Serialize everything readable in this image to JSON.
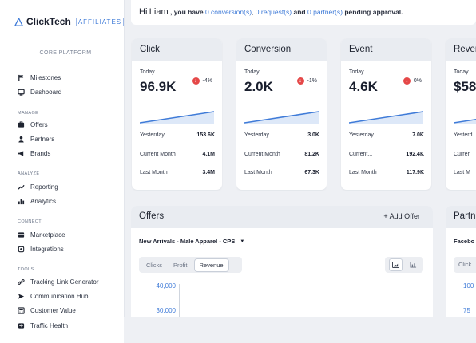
{
  "brand": {
    "name": "ClickTech",
    "affiliates": "AFFILIATES"
  },
  "sidebar": {
    "core_label": "CORE PLATFORM",
    "items_top": [
      {
        "label": "Milestones",
        "icon": "flag-icon"
      },
      {
        "label": "Dashboard",
        "icon": "dashboard-icon"
      }
    ],
    "manage_label": "MANAGE",
    "manage": [
      {
        "label": "Offers",
        "icon": "offers-icon"
      },
      {
        "label": "Partners",
        "icon": "user-icon"
      },
      {
        "label": "Brands",
        "icon": "megaphone-icon"
      }
    ],
    "analyze_label": "ANALYZE",
    "analyze": [
      {
        "label": "Reporting",
        "icon": "chart-line-icon"
      },
      {
        "label": "Analytics",
        "icon": "analytics-icon"
      }
    ],
    "connect_label": "CONNECT",
    "connect": [
      {
        "label": "Marketplace",
        "icon": "store-icon"
      },
      {
        "label": "Integrations",
        "icon": "plug-icon"
      }
    ],
    "tools_label": "TOOLS",
    "tools": [
      {
        "label": "Tracking Link Generator",
        "icon": "link-icon"
      },
      {
        "label": "Communication Hub",
        "icon": "send-icon"
      },
      {
        "label": "Customer Value",
        "icon": "calculator-icon"
      },
      {
        "label": "Traffic Health",
        "icon": "health-icon"
      }
    ]
  },
  "greeting": {
    "hi": "Hi",
    "name": "Liam",
    "you_have": ", you have",
    "conversions": "0 conversion(s)",
    "requests": "0 request(s)",
    "and": "and",
    "partners": "0 partner(s)",
    "tail": "pending approval."
  },
  "cards": [
    {
      "title": "Click",
      "today_label": "Today",
      "value": "96.9K",
      "change": "-4%",
      "yesterday_label": "Yesterday",
      "yesterday": "153.6K",
      "month_label": "Current Month",
      "month": "4.1M",
      "last_label": "Last Month",
      "last": "3.4M"
    },
    {
      "title": "Conversion",
      "today_label": "Today",
      "value": "2.0K",
      "change": "-1%",
      "yesterday_label": "Yesterday",
      "yesterday": "3.0K",
      "month_label": "Current Month",
      "month": "81.2K",
      "last_label": "Last Month",
      "last": "67.3K"
    },
    {
      "title": "Event",
      "today_label": "Today",
      "value": "4.6K",
      "change": "0%",
      "yesterday_label": "Yesterday",
      "yesterday": "7.0K",
      "month_label": "Current...",
      "month": "192.4K",
      "last_label": "Last Month",
      "last": "117.9K"
    },
    {
      "title": "Reven",
      "today_label": "Today",
      "value": "$58",
      "yesterday_label": "Yesterd",
      "month_label": "Curren",
      "last_label": "Last M"
    }
  ],
  "offers": {
    "title": "Offers",
    "add_label": "+ Add Offer",
    "campaign": "New Arrivals - Male Apparel - CPS",
    "tabs": [
      "Clicks",
      "Profit",
      "Revenue"
    ],
    "active_tab": "Revenue",
    "y_ticks": [
      "40,000",
      "30,000"
    ]
  },
  "partners": {
    "title": "Partn",
    "sub": "Facebo",
    "tab": "Click",
    "ticks": [
      "100",
      "75"
    ]
  },
  "colors": {
    "accent": "#3f7bd8",
    "negative": "#e54848",
    "header_bg": "#e9ecf1"
  }
}
